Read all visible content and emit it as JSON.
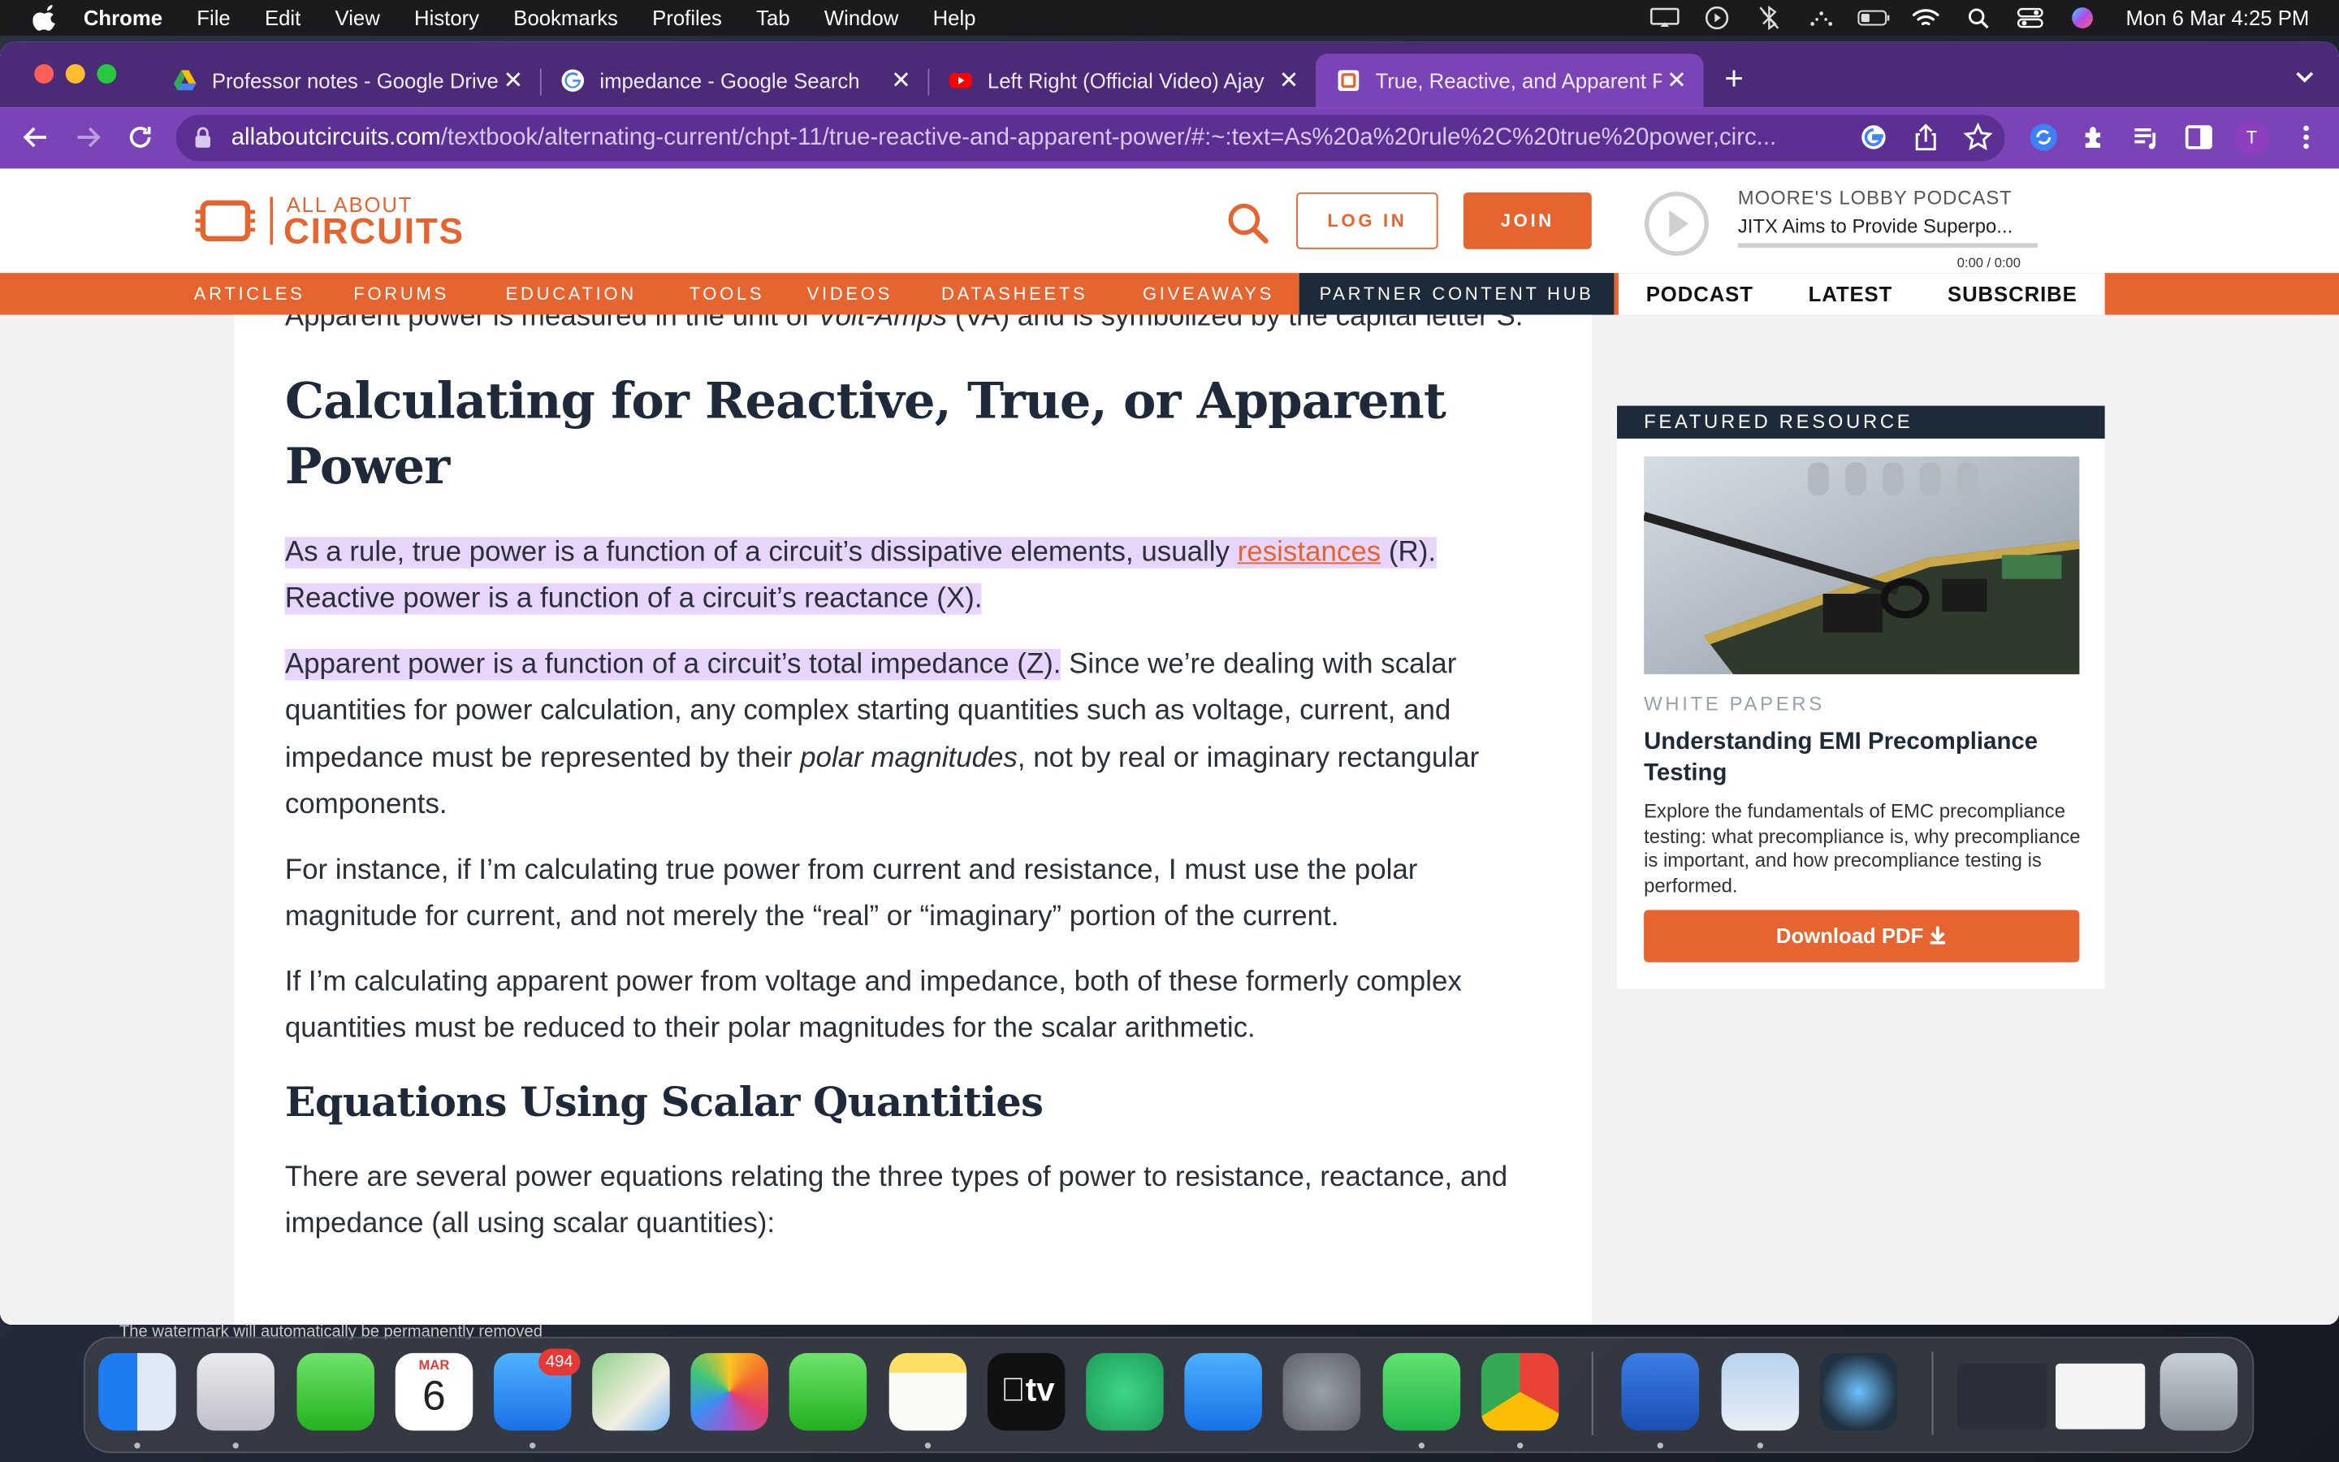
{
  "menubar": {
    "app": "Chrome",
    "items": [
      "File",
      "Edit",
      "View",
      "History",
      "Bookmarks",
      "Profiles",
      "Tab",
      "Window",
      "Help"
    ],
    "clock": "Mon 6 Mar  4:25 PM"
  },
  "tabs": [
    {
      "title": "Professor notes - Google Drive",
      "icon": "google-drive-icon"
    },
    {
      "title": "impedance - Google Search",
      "icon": "google-icon"
    },
    {
      "title": "Left Right (Official Video) Ajay",
      "icon": "youtube-icon"
    },
    {
      "title": "True, Reactive, and Apparent P",
      "icon": "allaboutcircuits-icon",
      "active": true
    }
  ],
  "address": {
    "domain": "allaboutcircuits.com",
    "path": "/textbook/alternating-current/chpt-11/true-reactive-and-apparent-power/#:~:text=As%20a%20rule%2C%20true%20power,circ..."
  },
  "profile_initial": "T",
  "site": {
    "logo_small": "ALL ABOUT",
    "logo_big": "CIRCUITS",
    "login": "LOG IN",
    "join": "JOIN",
    "podcast_title": "MOORE'S LOBBY PODCAST",
    "podcast_episode": "JITX Aims to Provide Superpo...",
    "podcast_time": "0:00 / 0:00",
    "podcast_progress": 0,
    "nav": [
      "ARTICLES",
      "FORUMS",
      "EDUCATION",
      "TOOLS",
      "VIDEOS",
      "DATASHEETS",
      "GIVEAWAYS"
    ],
    "partner": "PARTNER CONTENT HUB",
    "podtabs": [
      "PODCAST",
      "LATEST",
      "SUBSCRIBE"
    ]
  },
  "article": {
    "intro_a": "Apparent power is measured in the unit of ",
    "intro_em": "Volt-Amps",
    "intro_b": " (VA) and is symbolized by the capital letter S.",
    "h2": "Calculating for Reactive, True, or Apparent Power",
    "p1_hl_a": "As a rule, true power is a function of a circuit’s dissipative elements, usually ",
    "p1_link": "resistances",
    "p1_hl_b": " (R).",
    "p1_hl_c": "Reactive power is a function of a circuit’s reactance (X).",
    "p2_hl": "Apparent power is a function of a circuit’s total impedance (Z).",
    "p2_a": " Since we’re dealing with scalar quantities for power calculation, any complex starting quantities such as voltage, current, and impedance must be represented by their ",
    "p2_em": "polar magnitudes",
    "p2_b": ", not by real or imaginary rectangular components.",
    "p3": "For instance, if I’m calculating true power from current and resistance, I must use the polar magnitude for current, and not merely the “real” or “imaginary” portion of the current.",
    "p4": "If I’m calculating apparent power from voltage and impedance, both of these formerly complex quantities must be reduced to their polar magnitudes for the scalar arithmetic.",
    "h3": "Equations Using Scalar Quantities",
    "p5": "There are several power equations relating the three types of power to resistance, reactance, and impedance (all using scalar quantities):"
  },
  "featured": {
    "header": "FEATURED RESOURCE",
    "category": "WHITE PAPERS",
    "title": "Understanding EMI Precompliance Testing",
    "desc": "Explore the fundamentals of EMC precompliance testing: what precompliance is, why precompliance is important, and how precompliance testing is performed.",
    "button": "Download PDF"
  },
  "dock": {
    "apps": [
      "Finder",
      "Launchpad",
      "Messages",
      "Calendar",
      "Mail",
      "Maps",
      "Photos",
      "FaceTime",
      "Notes",
      "TV",
      "Find My",
      "App Store",
      "System Preferences",
      "WhatsApp",
      "Chrome",
      "Word",
      "Preview",
      "QuickTime Player",
      "Trash"
    ],
    "mail_badge": "494",
    "calendar_month": "MAR",
    "calendar_day": "6",
    "tv_label": "tv"
  },
  "colors": {
    "accent": "#e5642f",
    "chrome_purple": "#7a44b6",
    "highlight": "#e8d5fb",
    "navy": "#1d2a3a"
  }
}
